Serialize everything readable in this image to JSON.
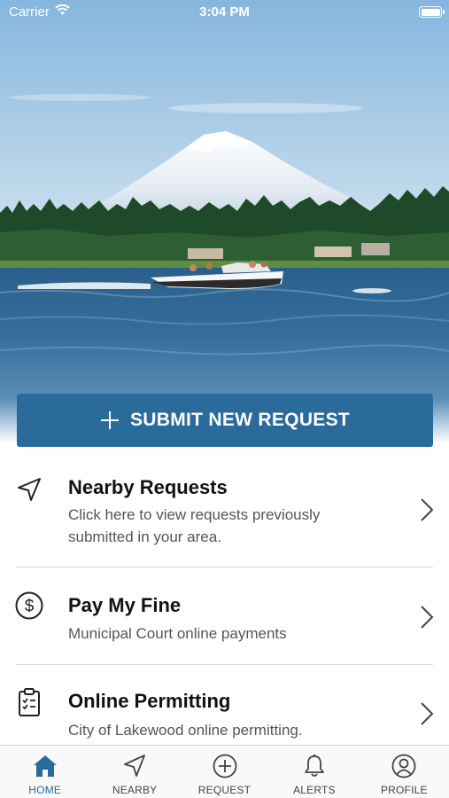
{
  "status_bar": {
    "carrier": "Carrier",
    "time": "3:04 PM"
  },
  "hero": {
    "image": "lake with speedboat and snow-capped mountain"
  },
  "submit_button": {
    "label": "SUBMIT NEW REQUEST",
    "icon": "plus-icon"
  },
  "list": [
    {
      "title": "Nearby Requests",
      "description": "Click here to view requests previously submitted in your area.",
      "icon": "location-arrow-icon"
    },
    {
      "title": "Pay My Fine",
      "description": "Municipal Court online payments",
      "icon": "dollar-circle-icon"
    },
    {
      "title": "Online Permitting",
      "description": "City of Lakewood online permitting.",
      "icon": "clipboard-checklist-icon"
    }
  ],
  "tab_bar": {
    "tabs": [
      {
        "label": "HOME",
        "icon": "home-icon",
        "active": true
      },
      {
        "label": "NEARBY",
        "icon": "location-arrow-icon",
        "active": false
      },
      {
        "label": "REQUEST",
        "icon": "plus-circle-icon",
        "active": false
      },
      {
        "label": "ALERTS",
        "icon": "bell-icon",
        "active": false
      },
      {
        "label": "PROFILE",
        "icon": "user-circle-icon",
        "active": false
      }
    ]
  },
  "colors": {
    "accent": "#2a6b9c",
    "text": "#111111",
    "subtext": "#555555",
    "divider": "#d9d9d9",
    "tab_bar_bg": "#f9f9f9"
  }
}
